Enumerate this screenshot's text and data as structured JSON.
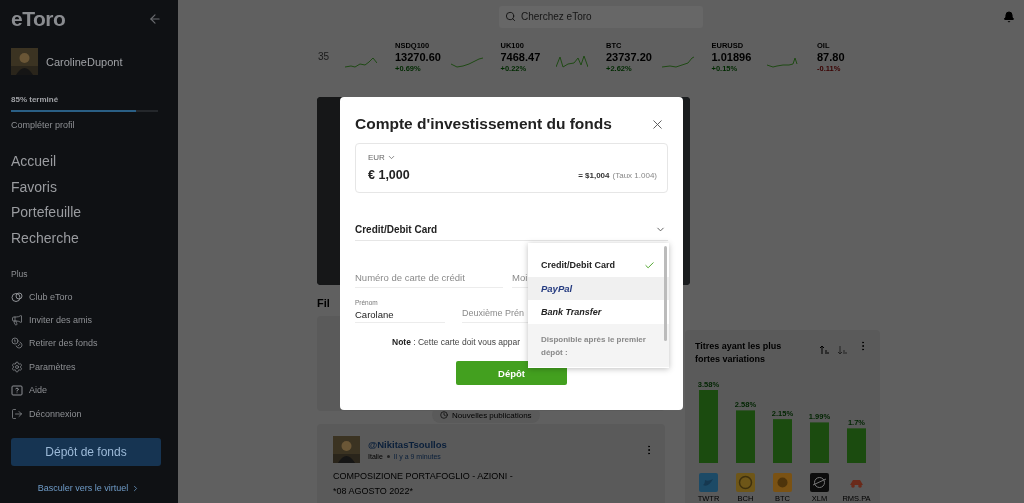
{
  "sidebar": {
    "logo": "eToro",
    "user": {
      "name": "CarolineDupont"
    },
    "profile": {
      "progress_label": "85% terminé",
      "level": 0.85,
      "link": "Compléter profil"
    },
    "nav": [
      "Accueil",
      "Favoris",
      "Portefeuille",
      "Recherche"
    ],
    "more_heading": "Plus",
    "more_items": [
      "Club eToro",
      "Inviter des amis",
      "Retirer des fonds",
      "Paramètres",
      "Aide",
      "Déconnexion"
    ],
    "deposit_button": "Dépôt de fonds",
    "virtual_link": "Basculer vers le virtuel"
  },
  "search": {
    "placeholder": "Cherchez eToro"
  },
  "ticker": {
    "partial": "35",
    "items": [
      {
        "name": "NSDQ100",
        "value": "13270.60",
        "change": "+0.69%",
        "negative": false
      },
      {
        "name": "UK100",
        "value": "7468.47",
        "change": "+0.22%",
        "negative": false
      },
      {
        "name": "BTC",
        "value": "23737.20",
        "change": "+2.62%",
        "negative": false
      },
      {
        "name": "EURUSD",
        "value": "1.01896",
        "change": "+0.15%",
        "negative": false
      },
      {
        "name": "OIL",
        "value": "87.80",
        "change": "-0.11%",
        "negative": true
      }
    ]
  },
  "feed": {
    "heading": "Fil",
    "new_posts": "Nouvelles publications",
    "post": {
      "author": "@NikitasTsoullos",
      "country": "Italie",
      "time": "Il y a 9 minutes",
      "lines": [
        "COMPOSIZIONE PORTAFOGLIO - AZIONI -",
        "*08 AGOSTO 2022*"
      ]
    }
  },
  "movers": {
    "title": "Titres ayant les plus fortes variations",
    "chart_data": {
      "type": "bar",
      "categories": [
        "TWTR",
        "BCH",
        "BTC",
        "XLM",
        "RMS.PA"
      ],
      "values": [
        3.58,
        2.58,
        2.15,
        1.99,
        1.7
      ],
      "value_labels": [
        "3.58%",
        "2.58%",
        "2.15%",
        "1.99%",
        "1.7%"
      ]
    }
  },
  "modal": {
    "title": "Compte d'investissement du fonds",
    "currency": "EUR",
    "amount": "€ 1,000",
    "converted": "= $1,004",
    "rate": "(Taux 1.004)",
    "method": "Credit/Debit Card",
    "card_number": {
      "placeholder": "Numéro de carte de crédit"
    },
    "month": {
      "placeholder": "Moi"
    },
    "first_name": {
      "label": "Prénom",
      "value": "Carolane"
    },
    "middle_name": {
      "placeholder": "Deuxième Prén"
    },
    "note": "**Note** : Cette carte doit vous appar",
    "submit": "Dépôt",
    "dropdown": {
      "options": [
        {
          "label": "Credit/Debit Card",
          "kind": "card",
          "selected": true,
          "highlighted": false
        },
        {
          "label": "PayPal",
          "kind": "paypal",
          "selected": false,
          "highlighted": true
        },
        {
          "label": "Bank Transfer",
          "kind": "bank",
          "selected": false,
          "highlighted": false
        }
      ],
      "section": "Disponible après le premier dépôt :"
    }
  }
}
